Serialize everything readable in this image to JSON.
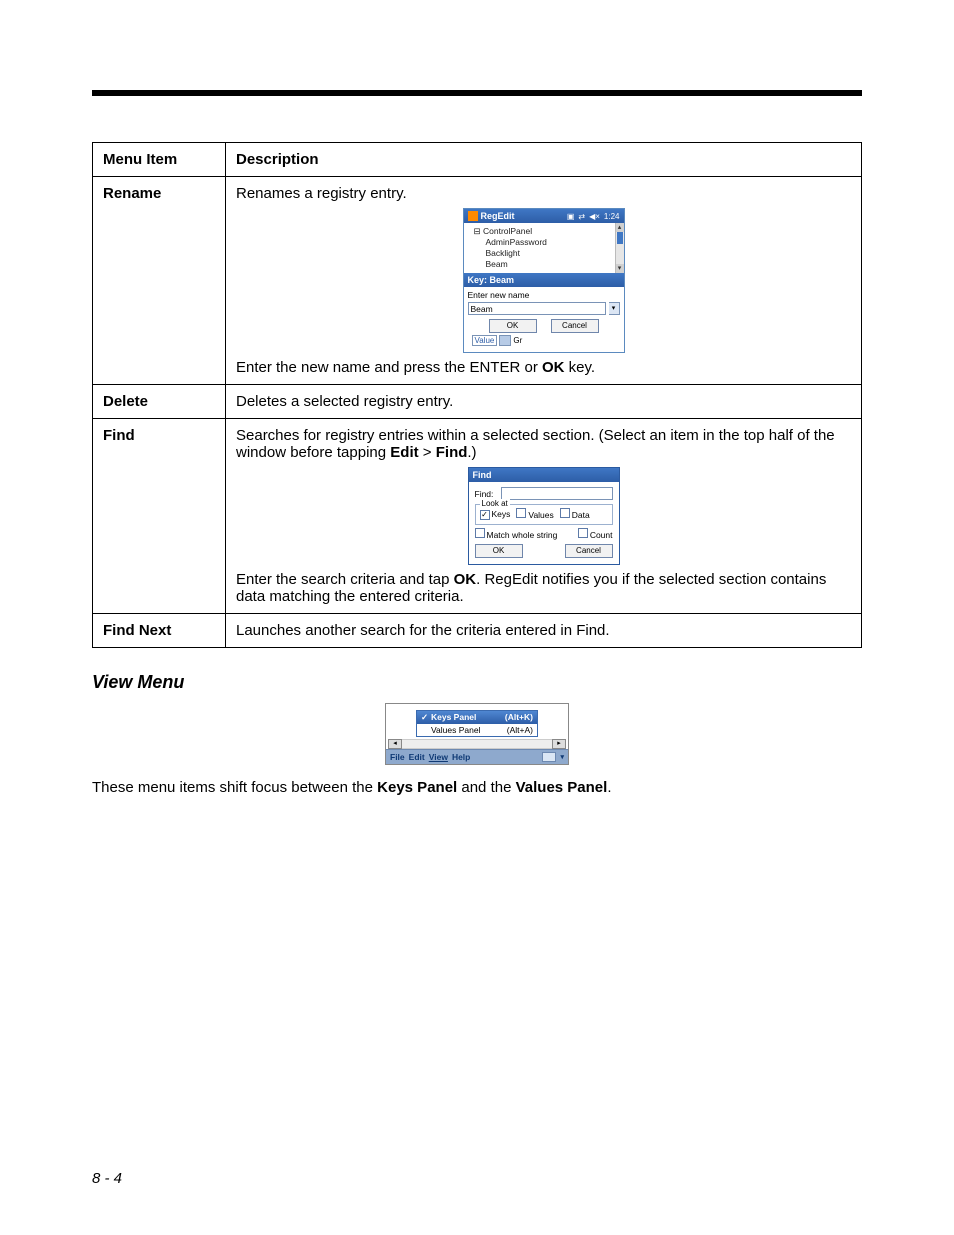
{
  "table": {
    "headers": {
      "menu_item": "Menu Item",
      "description": "Description"
    },
    "rows": {
      "rename": {
        "label": "Rename",
        "desc_before": "Renames a registry entry.",
        "desc_after_pre": "Enter the new name and press the ENTER or ",
        "desc_after_bold": "OK",
        "desc_after_post": " key."
      },
      "delete": {
        "label": "Delete",
        "desc": "Deletes a selected registry entry."
      },
      "find": {
        "label": "Find",
        "desc_before_1": "Searches for registry entries within a selected section. (Select an item in the top half of the window before tapping ",
        "desc_before_b1": "Edit",
        "desc_before_mid": " > ",
        "desc_before_b2": "Find",
        "desc_before_end": ".)",
        "desc_after_pre": "Enter the search criteria and tap ",
        "desc_after_bold": "OK",
        "desc_after_post": ". RegEdit notifies you if the selected section contains data matching the entered criteria."
      },
      "findnext": {
        "label": "Find Next",
        "desc": "Launches another search for the criteria entered in Find."
      }
    }
  },
  "regedit_shot": {
    "title": "RegEdit",
    "clock": "1:24",
    "tree": {
      "root": "ControlPanel",
      "children": [
        "AdminPassword",
        "Backlight",
        "Beam"
      ]
    },
    "key_bar": "Key: Beam",
    "field_label": "Enter new name",
    "field_value": "Beam",
    "value_tag": "Value",
    "gr_tag": "Gr",
    "ok": "OK",
    "cancel": "Cancel"
  },
  "find_shot": {
    "title": "Find",
    "find_label": "Find:",
    "lookat_legend": "Look at",
    "chk_keys": "Keys",
    "chk_values": "Values",
    "chk_data": "Data",
    "chk_match": "Match whole string",
    "chk_count": "Count",
    "ok": "OK",
    "cancel": "Cancel",
    "keys_checked": true
  },
  "view_section": {
    "heading": "View Menu",
    "para_pre": "These menu items shift focus between the ",
    "para_b1": "Keys Panel",
    "para_mid": " and the ",
    "para_b2": "Values Panel",
    "para_post": "."
  },
  "view_shot": {
    "item1_label": "Keys Panel",
    "item1_kb": "(Alt+K)",
    "item1_checked": true,
    "item2_label": "Values Panel",
    "item2_kb": "(Alt+A)",
    "menubar": {
      "file": "File",
      "edit": "Edit",
      "view": "View",
      "help": "Help"
    }
  },
  "page_number": "8 - 4"
}
